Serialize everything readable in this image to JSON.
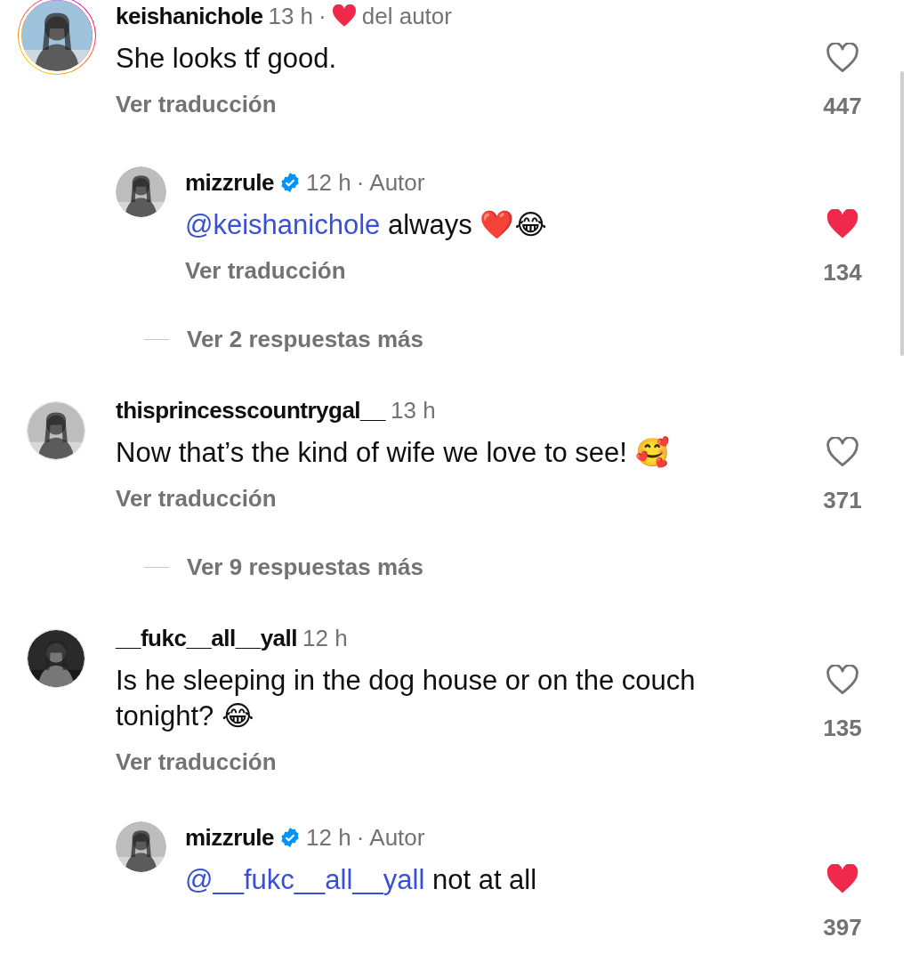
{
  "comments": [
    {
      "username": "keishanichole",
      "time": "13 h",
      "separator": "·",
      "author_like": "del autor",
      "story_ring": true,
      "body": [
        {
          "kind": "text",
          "text": "She looks tf good."
        }
      ],
      "translate": "Ver traducción",
      "liked": false,
      "likes": "447",
      "replies": [
        {
          "username": "mizzrule",
          "verified": true,
          "time": "12 h",
          "separator": "·",
          "role": "Autor",
          "body": [
            {
              "kind": "mention",
              "text": "@keishanichole"
            },
            {
              "kind": "text",
              "text": "always ❤️😂"
            }
          ],
          "translate": "Ver traducción",
          "liked": true,
          "likes": "134"
        }
      ],
      "more_replies": "Ver 2 respuestas más"
    },
    {
      "username": "thisprincesscountrygal__",
      "time": "13 h",
      "story_ring": false,
      "body": [
        {
          "kind": "text",
          "text": "Now that’s the kind of wife we love to see! 🥰"
        }
      ],
      "translate": "Ver traducción",
      "liked": false,
      "likes": "371",
      "more_replies": "Ver 9 respuestas más"
    },
    {
      "username": "__fukc__all__yall",
      "time": "12 h",
      "story_ring": false,
      "body": [
        {
          "kind": "text",
          "text": "Is he sleeping in the dog house or on the couch tonight? 😂"
        }
      ],
      "translate": "Ver traducción",
      "liked": false,
      "likes": "135",
      "replies": [
        {
          "username": "mizzrule",
          "verified": true,
          "time": "12 h",
          "separator": "·",
          "role": "Autor",
          "body": [
            {
              "kind": "mention",
              "text": "@__fukc__all__yall"
            },
            {
              "kind": "text",
              "text": "not at all"
            }
          ],
          "liked": true,
          "likes": "397"
        }
      ]
    }
  ]
}
